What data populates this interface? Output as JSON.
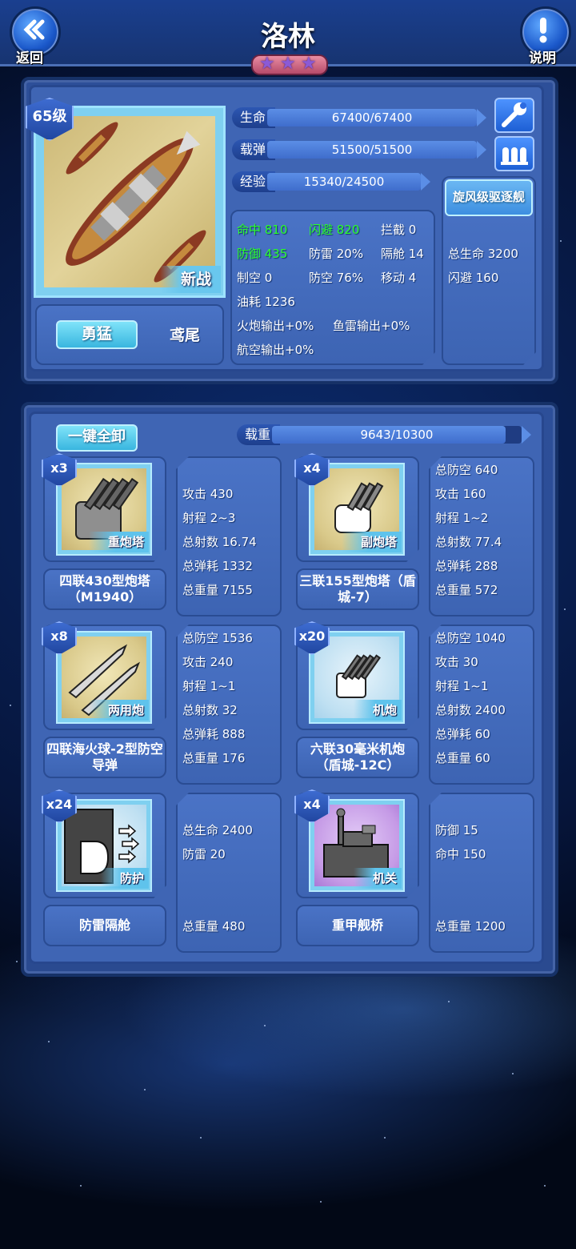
{
  "header": {
    "back_label": "返回",
    "help_label": "说明",
    "ship_name": "洛林",
    "stars": 3
  },
  "ship": {
    "level": "65级",
    "tag": "新战",
    "bars": [
      {
        "label": "生命",
        "text": "67400/67400",
        "fill": 1.0
      },
      {
        "label": "载弹",
        "text": "51500/51500",
        "fill": 1.0
      },
      {
        "label": "经验",
        "text": "15340/24500",
        "fill": 0.626
      }
    ],
    "stats": {
      "hit": "命中 810",
      "evasion": "闪避 820",
      "intercept": "拦截 0",
      "defense": "防御 435",
      "torpedo_def": "防雷 20%",
      "bulkhead": "隔舱 14",
      "air_control": "制空 0",
      "aa": "防空 76%",
      "move": "移动 4",
      "fuel": "油耗 1236",
      "gun_output": "火炮输出+0%",
      "torpedo_output": "鱼雷输出+0%",
      "air_output": "航空输出+0%"
    },
    "tabs": {
      "active": "勇猛",
      "inactive": "鸢尾"
    },
    "escort": {
      "name": "旋风级驱逐舰",
      "hp": "总生命 3200",
      "evasion": "闪避 160"
    }
  },
  "loadout": {
    "unload_all": "一键全卸",
    "weight_label": "载重",
    "weight_text": "9643/10300",
    "weight_fill": 0.936,
    "items": [
      {
        "count": "x3",
        "tag": "重炮塔",
        "name": "四联430型炮塔（M1940）",
        "stats": [
          "攻击 430",
          "射程 2~3",
          "总射数 16.74",
          "总弹耗 1332",
          "总重量 7155"
        ]
      },
      {
        "count": "x4",
        "tag": "副炮塔",
        "name": "三联155型炮塔（盾城-7）",
        "stats": [
          "总防空 640",
          "攻击 160",
          "射程 1~2",
          "总射数 77.4",
          "总弹耗 288",
          "总重量 572"
        ]
      },
      {
        "count": "x8",
        "tag": "两用炮",
        "name": "四联海火球-2型防空导弹",
        "stats": [
          "总防空 1536",
          "攻击 240",
          "射程 1~1",
          "总射数 32",
          "总弹耗 888",
          "总重量 176"
        ]
      },
      {
        "count": "x20",
        "tag": "机炮",
        "name": "六联30毫米机炮（盾城-12C）",
        "stats": [
          "总防空 1040",
          "攻击 30",
          "射程 1~1",
          "总射数 2400",
          "总弹耗 60",
          "总重量 60"
        ]
      },
      {
        "count": "x24",
        "tag": "防护",
        "name": "防雷隔舱",
        "stats": [
          "总生命 2400",
          "防雷 20",
          "总重量 480"
        ]
      },
      {
        "count": "x4",
        "tag": "机关",
        "name": "重甲舰桥",
        "stats": [
          "防御 15",
          "命中 150",
          "总重量 1200"
        ]
      }
    ]
  },
  "colors": {
    "green_stat": "#2bff2b",
    "panel": "#2d4f99",
    "accent": "#39b6df"
  }
}
